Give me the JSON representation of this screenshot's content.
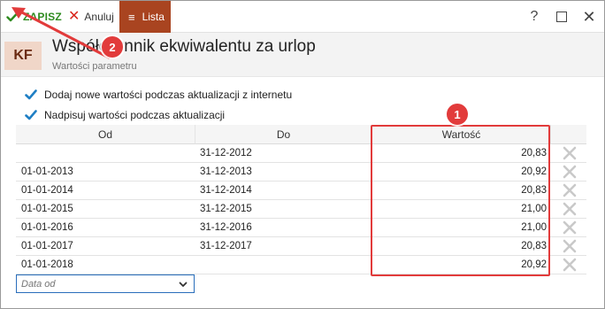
{
  "toolbar": {
    "save_label": "ZAPISZ",
    "cancel_label": "Anuluj",
    "list_label": "Lista",
    "help_label": "?"
  },
  "header": {
    "badge": "KF",
    "title": "Współczynnik ekwiwalentu za urlop",
    "subtitle": "Wartości parametru"
  },
  "options": [
    {
      "label": "Dodaj nowe wartości podczas aktualizacji z internetu",
      "checked": true
    },
    {
      "label": "Nadpisuj wartości podczas aktualizacji",
      "checked": true
    }
  ],
  "table": {
    "columns": [
      "Od",
      "Do",
      "Wartość"
    ],
    "rows": [
      {
        "od": "",
        "do": "31-12-2012",
        "value": "20,83"
      },
      {
        "od": "01-01-2013",
        "do": "31-12-2013",
        "value": "20,92"
      },
      {
        "od": "01-01-2014",
        "do": "31-12-2014",
        "value": "20,83"
      },
      {
        "od": "01-01-2015",
        "do": "31-12-2015",
        "value": "21,00"
      },
      {
        "od": "01-01-2016",
        "do": "31-12-2016",
        "value": "21,00"
      },
      {
        "od": "01-01-2017",
        "do": "31-12-2017",
        "value": "20,83"
      },
      {
        "od": "01-01-2018",
        "do": "",
        "value": "20,92"
      }
    ]
  },
  "new_row": {
    "placeholder": "Data od"
  },
  "annotations": {
    "marker1": "1",
    "marker2": "2"
  },
  "colors": {
    "accent": "#a94420",
    "save_green": "#2e8b1f",
    "cancel_red": "#d9261c",
    "annotation_red": "#e23b3b"
  },
  "icons": {
    "save": "check-icon",
    "cancel": "x-icon",
    "list": "hamburger-icon",
    "help": "question-icon",
    "maximize": "maximize-icon",
    "close": "close-icon",
    "delete_row": "delete-x-icon",
    "dropdown": "chevron-down-icon"
  }
}
